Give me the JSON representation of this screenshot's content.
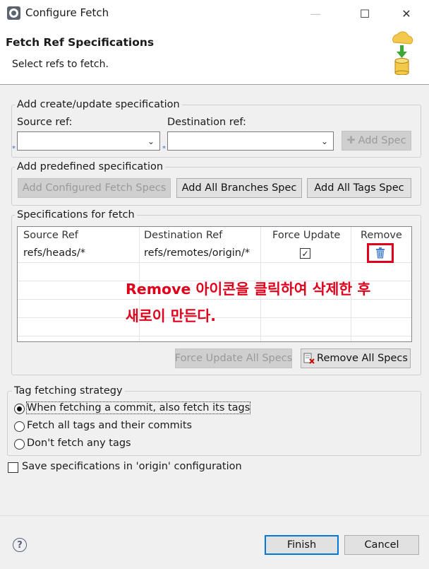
{
  "window": {
    "title": "Configure Fetch",
    "controls": {
      "minimize": "—",
      "maximize": "☐",
      "close": "✕"
    }
  },
  "header": {
    "title": "Fetch Ref Specifications",
    "subtitle": "Select refs to fetch.",
    "icon": "cloud-fetch-database-icon"
  },
  "create_group": {
    "legend": "Add create/update specification",
    "source_label": "Source ref:",
    "source_value": "",
    "destination_label": "Destination ref:",
    "destination_value": "",
    "add_spec_button": "Add Spec",
    "required_marker": "*"
  },
  "predefined_group": {
    "legend": "Add predefined specification",
    "buttons": {
      "configured": "Add Configured Fetch Specs",
      "branches": "Add All Branches Spec",
      "tags": "Add All Tags Spec"
    }
  },
  "specs_group": {
    "legend": "Specifications for fetch",
    "columns": {
      "source": "Source Ref",
      "destination": "Destination Ref",
      "force": "Force Update",
      "remove": "Remove"
    },
    "rows": [
      {
        "source": "refs/heads/*",
        "destination": "refs/remotes/origin/*",
        "force_update": true,
        "check_mark": "✓"
      }
    ],
    "annotation": {
      "line1": "Remove 아이콘을 클릭하여 삭제한 후",
      "line2": "새로이 만든다.",
      "color": "#e0001b"
    },
    "force_all_button": "Force Update All Specs",
    "remove_all_button": "Remove All Specs"
  },
  "tag_group": {
    "legend": "Tag fetching strategy",
    "options": [
      "When fetching a commit, also fetch its tags",
      "Fetch all tags and their commits",
      "Don't fetch any tags"
    ],
    "selected_index": 0
  },
  "save_checkbox": {
    "label": "Save specifications in 'origin' configuration",
    "checked": false
  },
  "footer": {
    "help": "?",
    "finish": "Finish",
    "cancel": "Cancel"
  },
  "colors": {
    "accent": "#0078d7",
    "annotation": "#e0001b",
    "trash": "#4a7fc4"
  }
}
